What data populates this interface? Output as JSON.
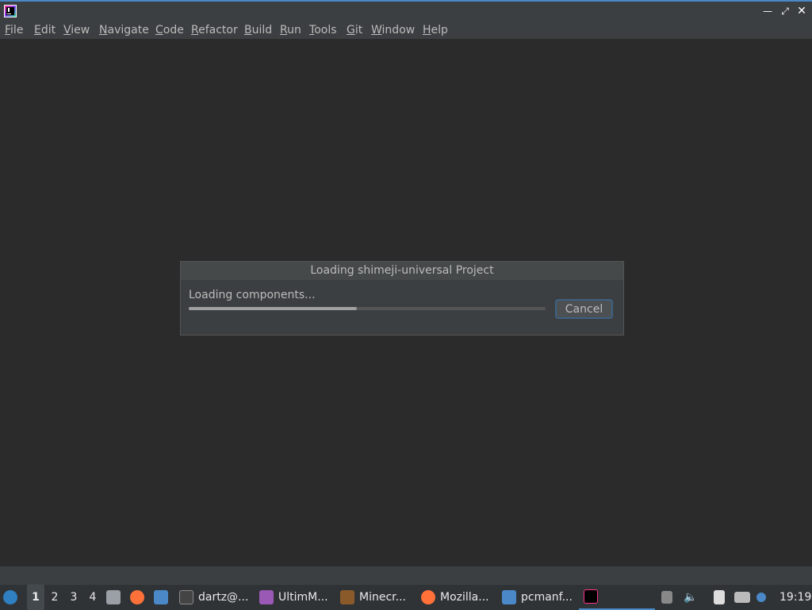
{
  "menu": {
    "items": [
      {
        "u": "F",
        "rest": "ile"
      },
      {
        "u": "E",
        "rest": "dit"
      },
      {
        "u": "V",
        "rest": "iew"
      },
      {
        "u": "N",
        "rest": "avigate"
      },
      {
        "u": "C",
        "rest": "ode"
      },
      {
        "u": "R",
        "rest": "efactor"
      },
      {
        "u": "B",
        "rest": "uild"
      },
      {
        "u": "R",
        "rest": "un"
      },
      {
        "u": "T",
        "rest": "ools"
      },
      {
        "u": "G",
        "rest": "it"
      },
      {
        "u": "W",
        "rest": "indow"
      },
      {
        "u": "H",
        "rest": "elp"
      }
    ]
  },
  "dialog": {
    "title": "Loading shimeji-universal Project",
    "status": "Loading components...",
    "progress": 0.47,
    "cancel_label": "Cancel"
  },
  "taskbar": {
    "desktops": [
      "1",
      "2",
      "3",
      "4"
    ],
    "active_desktop": "1",
    "tasks": [
      {
        "label": "dartz@...",
        "icon": "terminal-icon"
      },
      {
        "label": "UltimM...",
        "icon": "media-player-icon"
      },
      {
        "label": "Minecr...",
        "icon": "minecraft-icon"
      },
      {
        "label": "Mozilla...",
        "icon": "firefox-icon"
      },
      {
        "label": "pcmanf...",
        "icon": "folder-icon"
      }
    ],
    "clock": "19:19"
  },
  "colors": {
    "accent": "#4a88c7",
    "background": "#2b2b2b",
    "panel": "#3c3f41"
  }
}
